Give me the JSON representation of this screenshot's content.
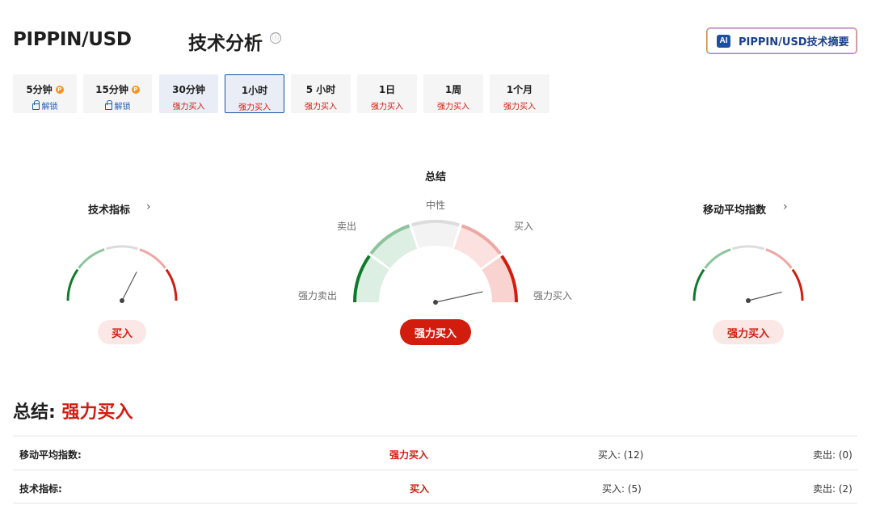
{
  "header": {
    "ticker": "PIPPIN/USD",
    "section": "技术分析",
    "info_icon": "ⓘ",
    "ai_badge": "AI",
    "ai_button": "PIPPIN/USD技术摘要"
  },
  "tabs": [
    {
      "label": "5分钟",
      "sub": "解锁",
      "locked": true
    },
    {
      "label": "15分钟",
      "sub": "解锁",
      "locked": true
    },
    {
      "label": "30分钟",
      "sub": "强力买入",
      "locked": false
    },
    {
      "label": "1小时",
      "sub": "强力买入",
      "locked": false,
      "active": true
    },
    {
      "label": "5 小时",
      "sub": "强力买入",
      "locked": false
    },
    {
      "label": "1日",
      "sub": "强力买入",
      "locked": false
    },
    {
      "label": "1周",
      "sub": "强力买入",
      "locked": false
    },
    {
      "label": "1个月",
      "sub": "强力买入",
      "locked": false
    }
  ],
  "gauges": {
    "indicators": {
      "title": "技术指标",
      "result": "买入",
      "needle_level": 0.65
    },
    "summary": {
      "title": "总结",
      "result": "强力买入",
      "needle_level": 0.93,
      "labels": {
        "strong_sell": "强力卖出",
        "sell": "卖出",
        "neutral": "中性",
        "buy": "买入",
        "strong_buy": "强力买入"
      }
    },
    "moving_averages": {
      "title": "移动平均指数",
      "result": "强力买入",
      "needle_level": 0.92
    }
  },
  "summary": {
    "label": "总结:",
    "verdict": "强力买入",
    "rows": [
      {
        "name": "移动平均指数:",
        "verdict": "强力买入",
        "buy": "买入: (12)",
        "sell": "卖出: (0)"
      },
      {
        "name": "技术指标:",
        "verdict": "买入",
        "buy": "买入: (5)",
        "sell": "卖出: (2)"
      }
    ]
  },
  "colors": {
    "strong_sell": "#0f7a2c",
    "sell": "#8cc49c",
    "neutral": "#dcdcdc",
    "buy": "#eea8a4",
    "strong_buy": "#d21c0e",
    "accent": "#1a4fa3"
  }
}
